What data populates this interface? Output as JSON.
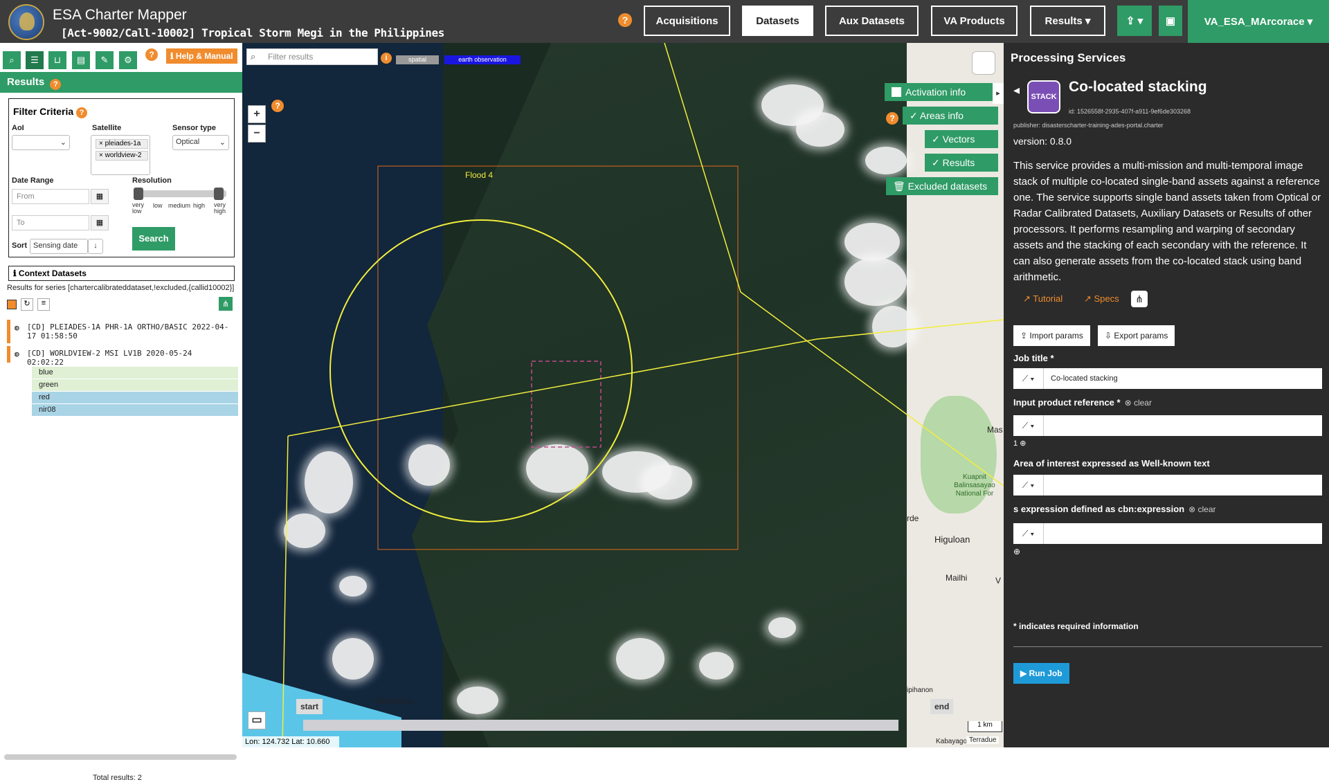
{
  "header": {
    "app_title": "ESA Charter Mapper",
    "activation": "[Act-9002/Call-10002] Tropical Storm Megi in the Philippines",
    "nav": [
      "Acquisitions",
      "Datasets",
      "Aux Datasets",
      "VA Products",
      "Results ▾"
    ],
    "active_tab": "Datasets",
    "upload_label": "⇪ ▾",
    "briefcase_label": "▣",
    "user": "VA_ESA_MArcorace ▾",
    "help": "?"
  },
  "left": {
    "help_manual": "Help & Manual",
    "results_title": "Results",
    "filter": {
      "title": "Filter Criteria",
      "aoi_label": "AoI",
      "satellite_label": "Satellite",
      "satellites": [
        "pleiades-1a",
        "worldview-2"
      ],
      "sensor_label": "Sensor type",
      "sensor_value": "Optical",
      "date_label": "Date Range",
      "from_placeholder": "From",
      "to_placeholder": "To",
      "resolution_label": "Resolution",
      "res_ticks": [
        "very low",
        "low",
        "medium",
        "high",
        "very high"
      ],
      "sort_label": "Sort",
      "sort_value": "Sensing date",
      "search": "Search"
    },
    "context_title": "Context Datasets",
    "series": "Results for series [chartercalibrateddataset,!excluded,{callid10002}]",
    "datasets": [
      "[CD] PLEIADES-1A PHR-1A ORTHO/BASIC 2022-04-17 01:58:50",
      "[CD] WORLDVIEW-2 MSI LV1B 2020-05-24 02:02:22"
    ],
    "bands": [
      {
        "name": "blue",
        "color": "#dff0d4"
      },
      {
        "name": "green",
        "color": "#dff0d4"
      },
      {
        "name": "red",
        "color": "#a9d4e6"
      },
      {
        "name": "nir08",
        "color": "#a9d4e6"
      }
    ],
    "total": "Total results: 2"
  },
  "map": {
    "filter_placeholder": "Filter results",
    "pill_spatial": "spatial",
    "pill_eo": "earth observation",
    "aoi_label": "Flood 4",
    "toggles": {
      "activation": "Activation info",
      "areas": "Areas info",
      "vectors": "Vectors",
      "results": "Results",
      "excluded": "Excluded datasets"
    },
    "time_start": "start",
    "time_end": "end",
    "scale": "1 km",
    "coords": "Lon: 124.732 Lat: 10.660",
    "attribution": "Terradue",
    "places": [
      "Bitanhuan",
      "Higuloan",
      "Mailhi",
      "Kuapnit Balinsasayao National For",
      "Mas",
      "rde",
      "ipihanon",
      "Kabayago",
      "V"
    ]
  },
  "right": {
    "title": "Processing Services",
    "icon_text": "STACK",
    "service_name": "Co-located stacking",
    "service_id": "id: 1526558f-2935-407f-a911-9ef6de303268",
    "publisher": "publisher: disasterscharter-training-ades-portal.charter",
    "version": "version: 0.8.0",
    "description": "This service provides a multi-mission and multi-temporal image stack of multiple co-located single-band assets against a reference one. The service supports single band assets taken from Optical or Radar Calibrated Datasets, Auxiliary Datasets or Results of other processors. It performs resampling and warping of secondary assets and the stacking of each secondary with the reference. It can also generate assets from the co-located stack using band arithmetic.",
    "tutorial": "Tutorial",
    "specs": "Specs",
    "import": "Import params",
    "export": "Export params",
    "job_title_label": "Job title *",
    "job_title_value": "Co-located stacking",
    "input_ref_label": "Input product reference *",
    "clear": "clear",
    "input_count": "1",
    "aoi_label": "Area of interest expressed as Well-known text",
    "expr_label": "s expression defined as cbn:expression",
    "required_note": "* indicates required information",
    "run": "Run Job"
  }
}
